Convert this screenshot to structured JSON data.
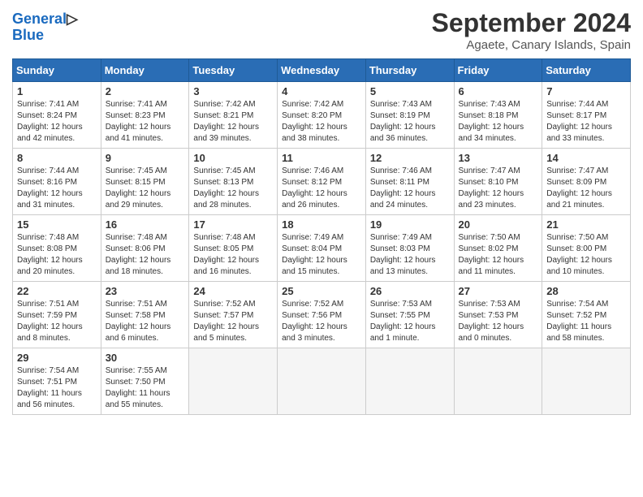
{
  "header": {
    "logo_line1": "General",
    "logo_line2": "Blue",
    "month_year": "September 2024",
    "location": "Agaete, Canary Islands, Spain"
  },
  "columns": [
    "Sunday",
    "Monday",
    "Tuesday",
    "Wednesday",
    "Thursday",
    "Friday",
    "Saturday"
  ],
  "weeks": [
    [
      {
        "day": "1",
        "info": "Sunrise: 7:41 AM\nSunset: 8:24 PM\nDaylight: 12 hours and 42 minutes."
      },
      {
        "day": "2",
        "info": "Sunrise: 7:41 AM\nSunset: 8:23 PM\nDaylight: 12 hours and 41 minutes."
      },
      {
        "day": "3",
        "info": "Sunrise: 7:42 AM\nSunset: 8:21 PM\nDaylight: 12 hours and 39 minutes."
      },
      {
        "day": "4",
        "info": "Sunrise: 7:42 AM\nSunset: 8:20 PM\nDaylight: 12 hours and 38 minutes."
      },
      {
        "day": "5",
        "info": "Sunrise: 7:43 AM\nSunset: 8:19 PM\nDaylight: 12 hours and 36 minutes."
      },
      {
        "day": "6",
        "info": "Sunrise: 7:43 AM\nSunset: 8:18 PM\nDaylight: 12 hours and 34 minutes."
      },
      {
        "day": "7",
        "info": "Sunrise: 7:44 AM\nSunset: 8:17 PM\nDaylight: 12 hours and 33 minutes."
      }
    ],
    [
      {
        "day": "8",
        "info": "Sunrise: 7:44 AM\nSunset: 8:16 PM\nDaylight: 12 hours and 31 minutes."
      },
      {
        "day": "9",
        "info": "Sunrise: 7:45 AM\nSunset: 8:15 PM\nDaylight: 12 hours and 29 minutes."
      },
      {
        "day": "10",
        "info": "Sunrise: 7:45 AM\nSunset: 8:13 PM\nDaylight: 12 hours and 28 minutes."
      },
      {
        "day": "11",
        "info": "Sunrise: 7:46 AM\nSunset: 8:12 PM\nDaylight: 12 hours and 26 minutes."
      },
      {
        "day": "12",
        "info": "Sunrise: 7:46 AM\nSunset: 8:11 PM\nDaylight: 12 hours and 24 minutes."
      },
      {
        "day": "13",
        "info": "Sunrise: 7:47 AM\nSunset: 8:10 PM\nDaylight: 12 hours and 23 minutes."
      },
      {
        "day": "14",
        "info": "Sunrise: 7:47 AM\nSunset: 8:09 PM\nDaylight: 12 hours and 21 minutes."
      }
    ],
    [
      {
        "day": "15",
        "info": "Sunrise: 7:48 AM\nSunset: 8:08 PM\nDaylight: 12 hours and 20 minutes."
      },
      {
        "day": "16",
        "info": "Sunrise: 7:48 AM\nSunset: 8:06 PM\nDaylight: 12 hours and 18 minutes."
      },
      {
        "day": "17",
        "info": "Sunrise: 7:48 AM\nSunset: 8:05 PM\nDaylight: 12 hours and 16 minutes."
      },
      {
        "day": "18",
        "info": "Sunrise: 7:49 AM\nSunset: 8:04 PM\nDaylight: 12 hours and 15 minutes."
      },
      {
        "day": "19",
        "info": "Sunrise: 7:49 AM\nSunset: 8:03 PM\nDaylight: 12 hours and 13 minutes."
      },
      {
        "day": "20",
        "info": "Sunrise: 7:50 AM\nSunset: 8:02 PM\nDaylight: 12 hours and 11 minutes."
      },
      {
        "day": "21",
        "info": "Sunrise: 7:50 AM\nSunset: 8:00 PM\nDaylight: 12 hours and 10 minutes."
      }
    ],
    [
      {
        "day": "22",
        "info": "Sunrise: 7:51 AM\nSunset: 7:59 PM\nDaylight: 12 hours and 8 minutes."
      },
      {
        "day": "23",
        "info": "Sunrise: 7:51 AM\nSunset: 7:58 PM\nDaylight: 12 hours and 6 minutes."
      },
      {
        "day": "24",
        "info": "Sunrise: 7:52 AM\nSunset: 7:57 PM\nDaylight: 12 hours and 5 minutes."
      },
      {
        "day": "25",
        "info": "Sunrise: 7:52 AM\nSunset: 7:56 PM\nDaylight: 12 hours and 3 minutes."
      },
      {
        "day": "26",
        "info": "Sunrise: 7:53 AM\nSunset: 7:55 PM\nDaylight: 12 hours and 1 minute."
      },
      {
        "day": "27",
        "info": "Sunrise: 7:53 AM\nSunset: 7:53 PM\nDaylight: 12 hours and 0 minutes."
      },
      {
        "day": "28",
        "info": "Sunrise: 7:54 AM\nSunset: 7:52 PM\nDaylight: 11 hours and 58 minutes."
      }
    ],
    [
      {
        "day": "29",
        "info": "Sunrise: 7:54 AM\nSunset: 7:51 PM\nDaylight: 11 hours and 56 minutes."
      },
      {
        "day": "30",
        "info": "Sunrise: 7:55 AM\nSunset: 7:50 PM\nDaylight: 11 hours and 55 minutes."
      },
      {
        "day": "",
        "info": ""
      },
      {
        "day": "",
        "info": ""
      },
      {
        "day": "",
        "info": ""
      },
      {
        "day": "",
        "info": ""
      },
      {
        "day": "",
        "info": ""
      }
    ]
  ]
}
